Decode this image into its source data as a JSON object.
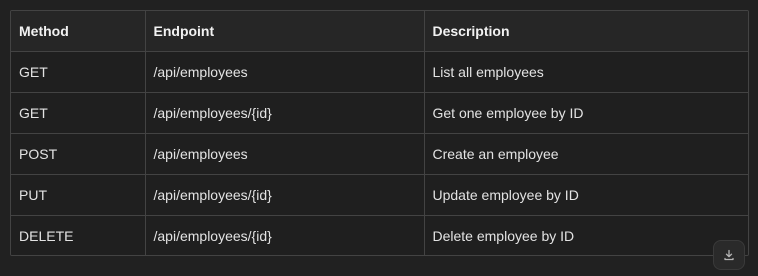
{
  "table": {
    "headers": [
      "Method",
      "Endpoint",
      "Description"
    ],
    "rows": [
      [
        "GET",
        "/api/employees",
        "List all employees"
      ],
      [
        "GET",
        "/api/employees/{id}",
        "Get one employee by ID"
      ],
      [
        "POST",
        "/api/employees",
        "Create an employee"
      ],
      [
        "PUT",
        "/api/employees/{id}",
        "Update employee by ID"
      ],
      [
        "DELETE",
        "/api/employees/{id}",
        "Delete employee by ID"
      ]
    ]
  },
  "download": {
    "icon": "download-icon"
  }
}
